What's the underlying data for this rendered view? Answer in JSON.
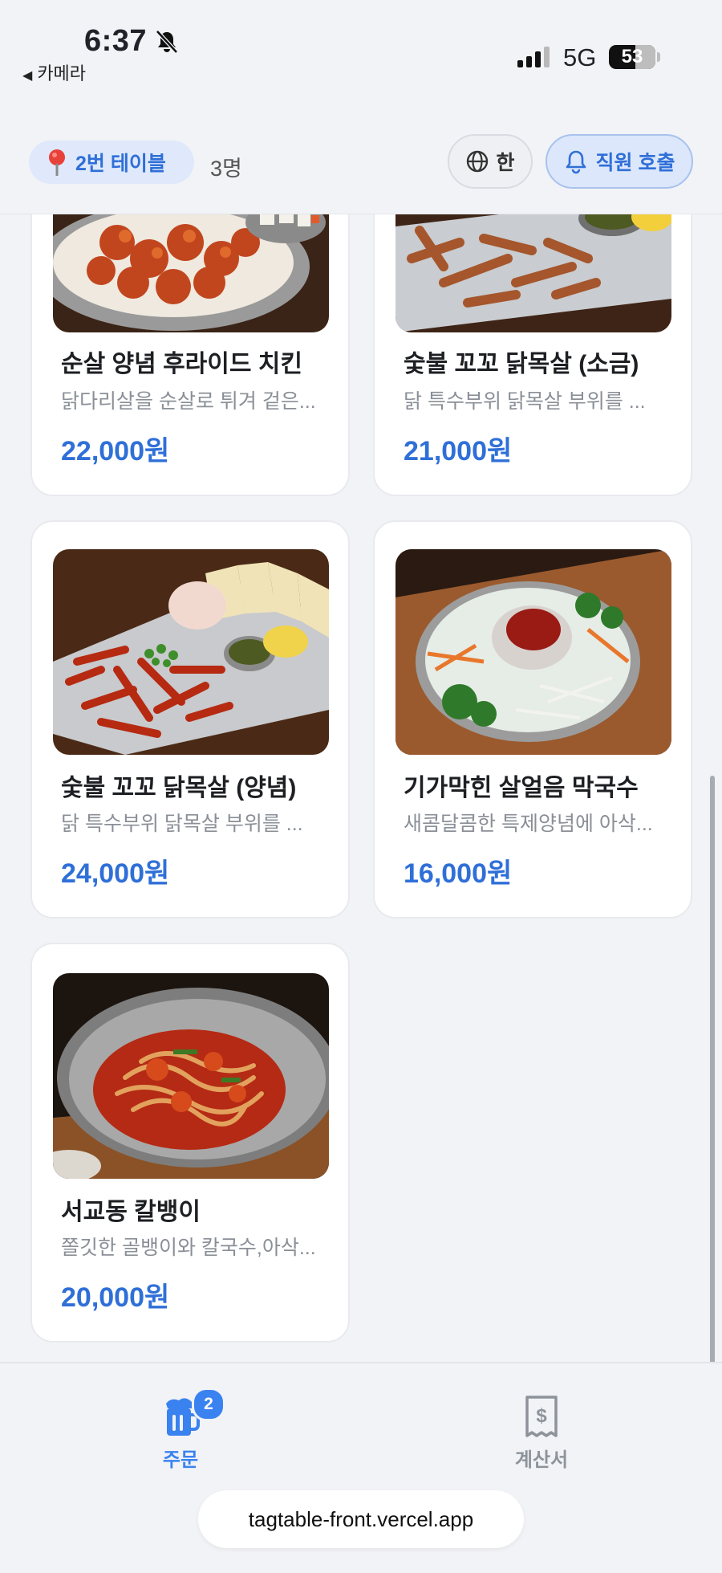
{
  "status_bar": {
    "time": "6:37",
    "back_app": "카메라",
    "network": "5G",
    "battery": "53"
  },
  "header": {
    "table_label": "2번 테이블",
    "guest_count": "3명",
    "language_label": "한",
    "call_staff_label": "직원 호출"
  },
  "menu_items": [
    {
      "name": "순살 양념 후라이드 치킨",
      "description": "닭다리살을 순살로 튀겨 겉은...",
      "price": "22,000원",
      "photo_icon": "fried-chicken"
    },
    {
      "name": "숯불 꼬꼬 닭목살 (소금)",
      "description": "닭 특수부위 닭목살 부위를 ...",
      "price": "21,000원",
      "photo_icon": "grilled-chicken-neck"
    },
    {
      "name": "숯불 꼬꼬 닭목살 (양념)",
      "description": "닭 특수부위 닭목살 부위를 ...",
      "price": "24,000원",
      "photo_icon": "spicy-chicken-neck"
    },
    {
      "name": "기가막힌 살얼음 막국수",
      "description": "새콤달콤한 특제양념에 아삭...",
      "price": "16,000원",
      "photo_icon": "cold-noodles"
    },
    {
      "name": "서교동 칼뱅이",
      "description": "쫄깃한 골뱅이와 칼국수,아삭...",
      "price": "20,000원",
      "photo_icon": "spicy-whelk-noodles"
    }
  ],
  "bottom_nav": {
    "order_label": "주문",
    "order_badge": "2",
    "bill_label": "계산서"
  },
  "browser": {
    "url": "tagtable-front.vercel.app"
  },
  "colors": {
    "accent": "#2f6fd8",
    "badge": "#3a82f0",
    "background": "#f2f3f6"
  }
}
